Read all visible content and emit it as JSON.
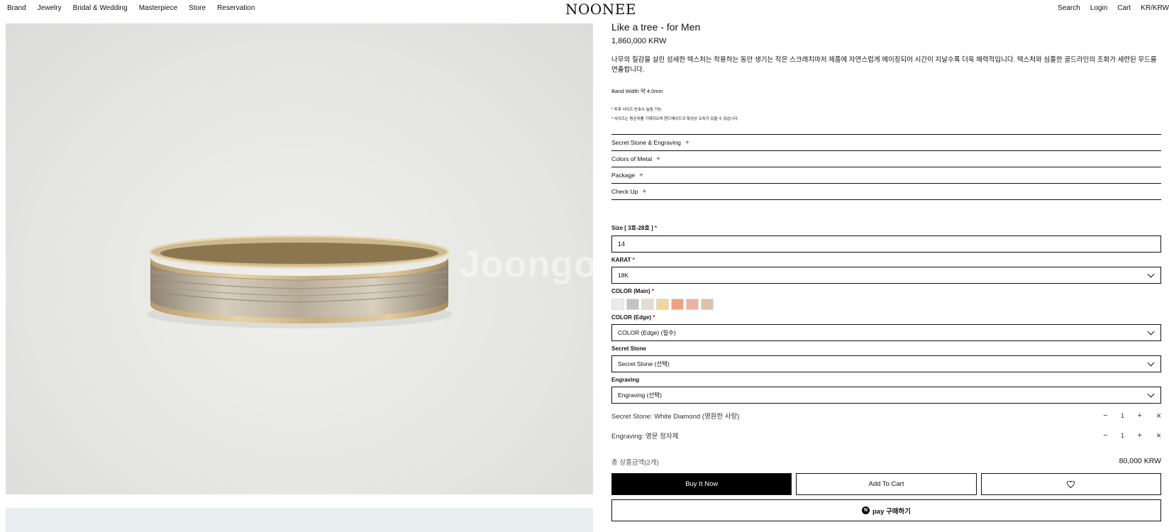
{
  "header": {
    "nav_left": [
      "Brand",
      "Jewelry",
      "Bridal & Wedding",
      "Masterpiece",
      "Store",
      "Reservation"
    ],
    "logo": "NOONEE",
    "nav_right": [
      "Search",
      "Login",
      "Cart",
      "KR/KRW"
    ]
  },
  "gallery": {
    "watermark": "Joongo"
  },
  "product": {
    "title": "Like a tree - for Men",
    "price": "1,860,000 KRW",
    "description": "나무의 질감을 살린 섬세한 텍스처는 착용하는 동안 생기는 작은 스크래치마저 제품에 자연스럽게 에이징되어 시간이 지날수록 더욱 매력적입니다. 텍스처와 심플한 골드라인의 조화가 세련된 무드를 연출합니다.",
    "band_width": "Band Width 약 4.0mm",
    "notes": [
      "* 추후 사이즈 반호수 늘림 가능",
      "* 사이즈는 평균치를 기재하오며 핸드메이드의 특성상 오차가 있을 수 있습니다."
    ],
    "accordion": [
      "Secret Stone & Engraving",
      "Colors of Metal",
      "Package",
      "Check Up"
    ],
    "accordion_icon": "+"
  },
  "options": {
    "required_mark": "*",
    "size": {
      "label": "Size [ 3호-28호 ]",
      "value": "14"
    },
    "karat": {
      "label": "KARAT",
      "value": "18K"
    },
    "color_main": {
      "label": "COLOR (Main)",
      "swatches": [
        "#ebebeb",
        "#c4c4c4",
        "#e2ddd3",
        "#f0d69c",
        "#eaa47e",
        "#edb2a4",
        "#dfc0aa"
      ]
    },
    "color_edge": {
      "label": "COLOR (Edge)",
      "value": "COLOR (Edge) (필수)"
    },
    "secret_stone": {
      "label": "Secret Stone",
      "value": "Secret Stone (선택)"
    },
    "engraving": {
      "label": "Engraving",
      "value": "Engraving (선택)"
    }
  },
  "selected": [
    {
      "name": "Secret Stone: White Diamond (영원한 사랑)",
      "qty": "1"
    },
    {
      "name": "Engraving: 영문 정자체",
      "qty": "1"
    }
  ],
  "stepper": {
    "minus": "−",
    "plus": "+",
    "remove": "×"
  },
  "total": {
    "label": "총 상품금액(2개)",
    "value": "80,000 KRW"
  },
  "buttons": {
    "buy": "Buy It Now",
    "cart": "Add To Cart",
    "npay_n": "N",
    "npay": "pay 구매하기"
  }
}
